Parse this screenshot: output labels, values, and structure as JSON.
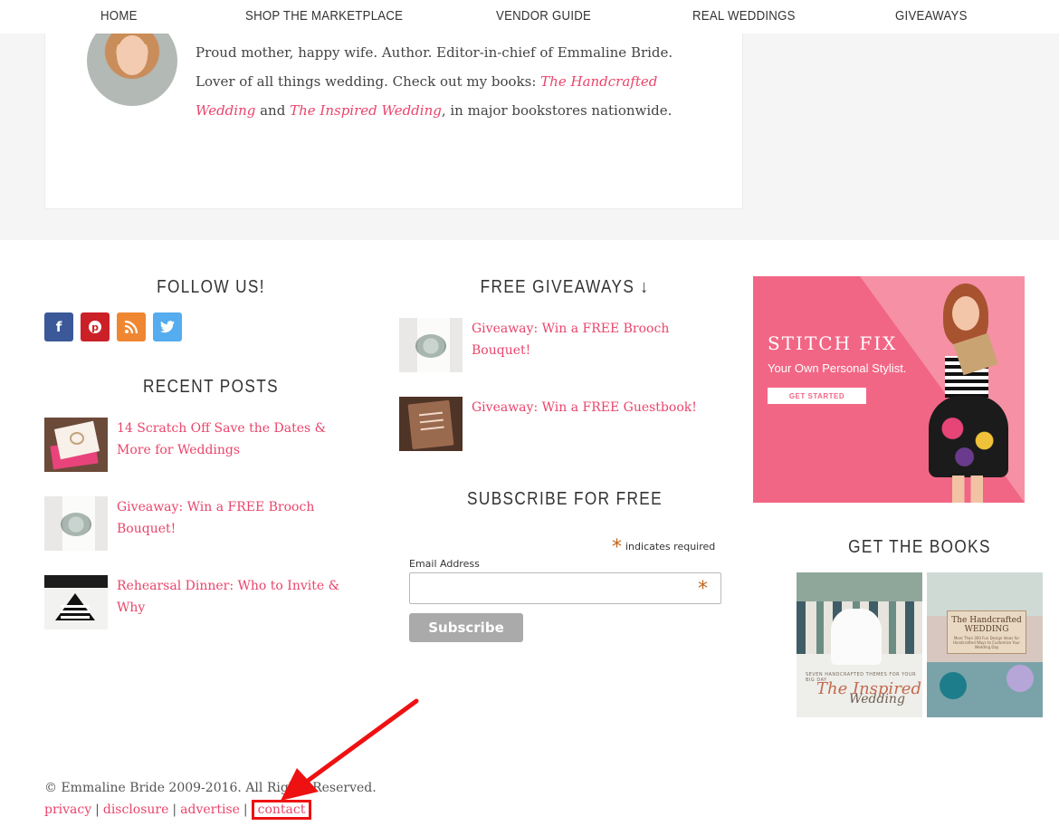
{
  "nav": {
    "items": [
      "HOME",
      "SHOP THE MARKETPLACE",
      "VENDOR GUIDE",
      "REAL WEDDINGS",
      "GIVEAWAYS"
    ]
  },
  "author": {
    "bio_intro": "Proud mother, happy wife. Author. Editor-in-chief of Emmaline Bride. Lover of all things wedding. Check out my books: ",
    "book1": "The Handcrafted Wedding",
    "and": " and ",
    "book2": "The Inspired Wedding",
    "bio_end": ", in major bookstores nationwide."
  },
  "follow": {
    "title": "FOLLOW US!",
    "icons": [
      {
        "name": "facebook-icon",
        "glyph": "f",
        "color": "#3b5998"
      },
      {
        "name": "pinterest-icon",
        "glyph": "P",
        "color": "#cb2027"
      },
      {
        "name": "rss-icon",
        "glyph": "rss",
        "color": "#ef8732"
      },
      {
        "name": "twitter-icon",
        "glyph": "t",
        "color": "#55acee"
      }
    ]
  },
  "recent_posts": {
    "title": "RECENT POSTS",
    "items": [
      {
        "title": "14 Scratch Off Save the Dates & More for Weddings"
      },
      {
        "title": "Giveaway: Win a FREE Brooch Bouquet!"
      },
      {
        "title": "Rehearsal Dinner: Who to Invite & Why"
      }
    ]
  },
  "giveaways": {
    "title": "FREE GIVEAWAYS ↓",
    "items": [
      {
        "title": "Giveaway: Win a FREE Brooch Bouquet!"
      },
      {
        "title": "Giveaway: Win a FREE Guestbook!"
      }
    ]
  },
  "subscribe": {
    "title": "SUBSCRIBE FOR FREE",
    "required_asterisk": "*",
    "required_note": "indicates required",
    "email_label": "Email Address",
    "email_value": "",
    "button_label": "Subscribe"
  },
  "ad": {
    "brand": "STITCH FIX",
    "tagline": "Your Own Personal Stylist.",
    "cta": "GET STARTED"
  },
  "books": {
    "title": "GET THE BOOKS",
    "inspired": {
      "tagline": "SEVEN HANDCRAFTED THEMES FOR YOUR BIG DAY",
      "word1": "The Inspired",
      "word2": "Wedding"
    },
    "handcrafted": {
      "title": "The Handcrafted WEDDING",
      "subtitle": "More Than 300 Fun Design Ideas for Handcrafted Ways to Customize Your Wedding Day"
    }
  },
  "footer": {
    "copyright": "© Emmaline Bride 2009-2016. All Rights Reserved.",
    "links": [
      "privacy",
      "disclosure",
      "advertise",
      "contact"
    ],
    "separator": "|"
  },
  "colors": {
    "accent_link": "#e9456b",
    "ad_pink": "#f26685",
    "annotation_red": "#ee1111"
  }
}
